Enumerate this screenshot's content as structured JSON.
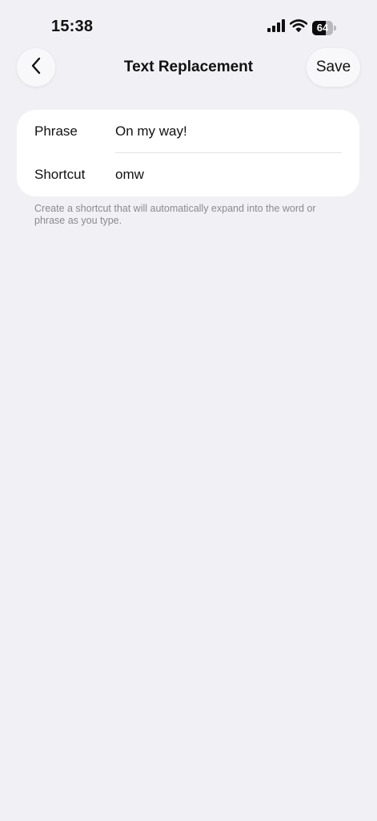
{
  "status_bar": {
    "time": "15:38",
    "battery_level": "64",
    "battery_fraction": 0.64,
    "icons": [
      "signal-icon",
      "wifi-icon",
      "battery-icon"
    ]
  },
  "nav": {
    "title": "Text Replacement",
    "back_icon": "chevron-left-icon",
    "save_label": "Save"
  },
  "form": {
    "phrase": {
      "label": "Phrase",
      "value": "On my way!"
    },
    "shortcut": {
      "label": "Shortcut",
      "value": "omw"
    }
  },
  "footnote": "Create a shortcut that will automatically expand into the word or phrase as you type.",
  "colors": {
    "background": "#f1f0f5",
    "card": "#ffffff",
    "footnote_text": "#8a8a8f"
  }
}
